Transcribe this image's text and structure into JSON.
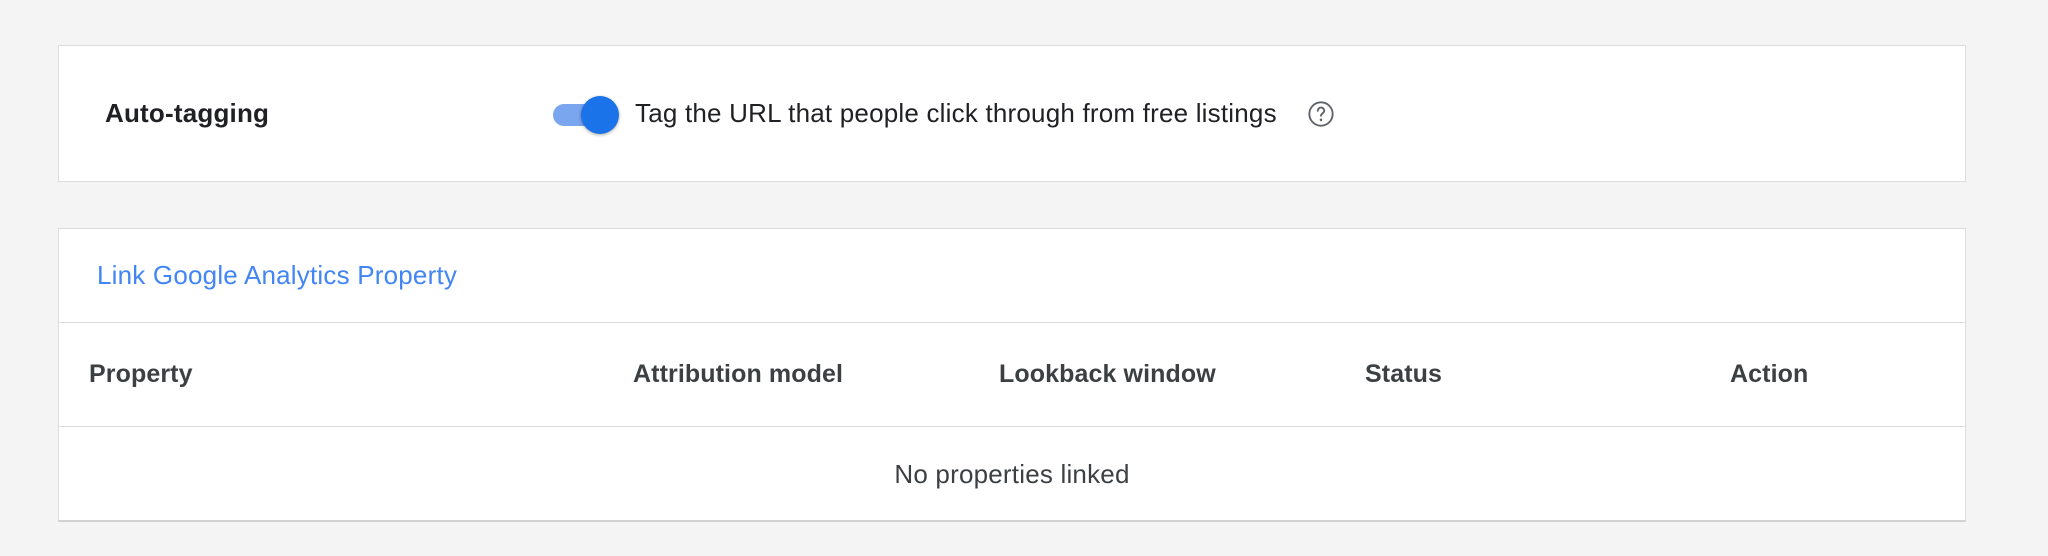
{
  "auto_tagging": {
    "title": "Auto-tagging",
    "toggle_state": "on",
    "description": "Tag the URL that people click through from free listings",
    "help_icon": "help-circle-icon"
  },
  "analytics": {
    "link_label": "Link Google Analytics Property",
    "columns": [
      "Property",
      "Attribution model",
      "Lookback window",
      "Status",
      "Action"
    ],
    "empty_message": "No properties linked"
  },
  "colors": {
    "accent": "#1a73e8",
    "link": "#4285f4",
    "toggle_track": "#7aa5ef",
    "background": "#f4f4f4"
  }
}
